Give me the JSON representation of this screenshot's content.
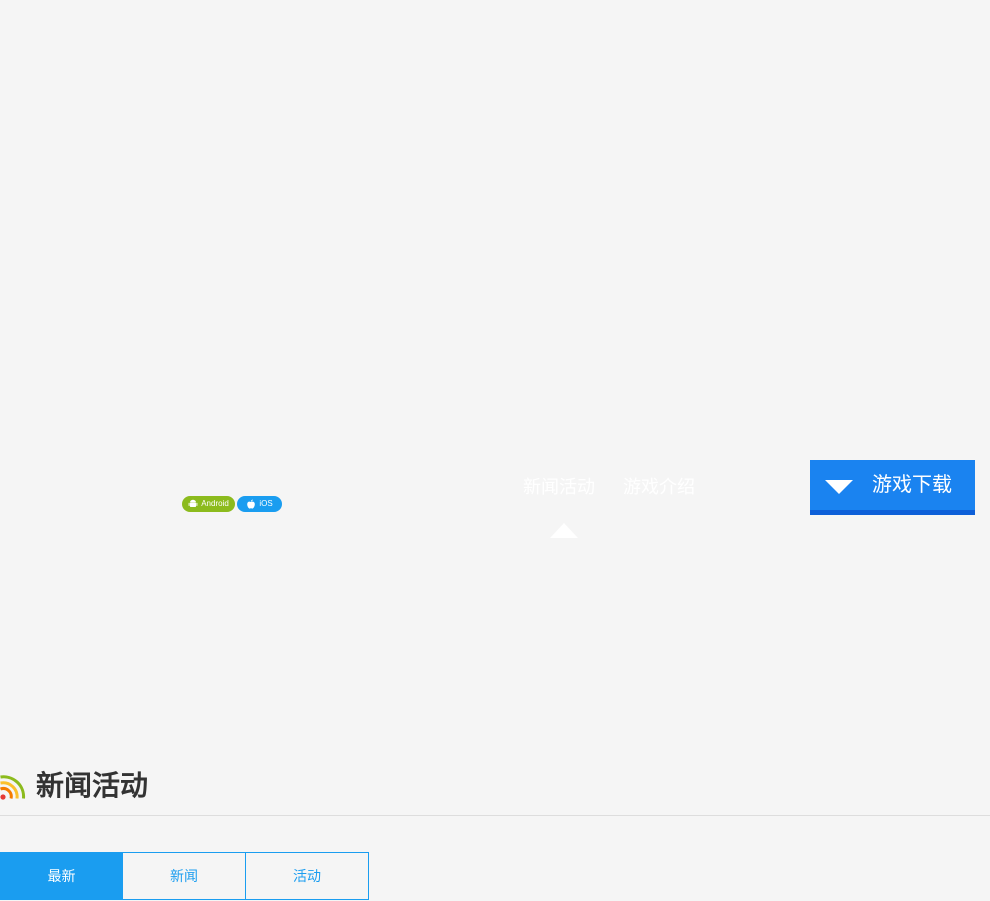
{
  "platforms": {
    "android_label": "Android",
    "ios_label": "iOS"
  },
  "nav": {
    "items": [
      {
        "label": "新闻活动",
        "active": true
      },
      {
        "label": "游戏介绍",
        "active": false
      }
    ]
  },
  "download": {
    "label": "游戏下载",
    "icon": "chevron-down-icon"
  },
  "section": {
    "title": "新闻活动",
    "icon": "rss-icon"
  },
  "tabs": [
    {
      "label": "最新",
      "active": true
    },
    {
      "label": "新闻",
      "active": false
    },
    {
      "label": "活动",
      "active": false
    }
  ],
  "colors": {
    "background": "#f5f5f5",
    "accent": "#1a9df0",
    "download_button": "#1a83f0",
    "android_badge": "#8cbb1d",
    "ios_badge": "#1a9df0",
    "title_text": "#333333"
  }
}
